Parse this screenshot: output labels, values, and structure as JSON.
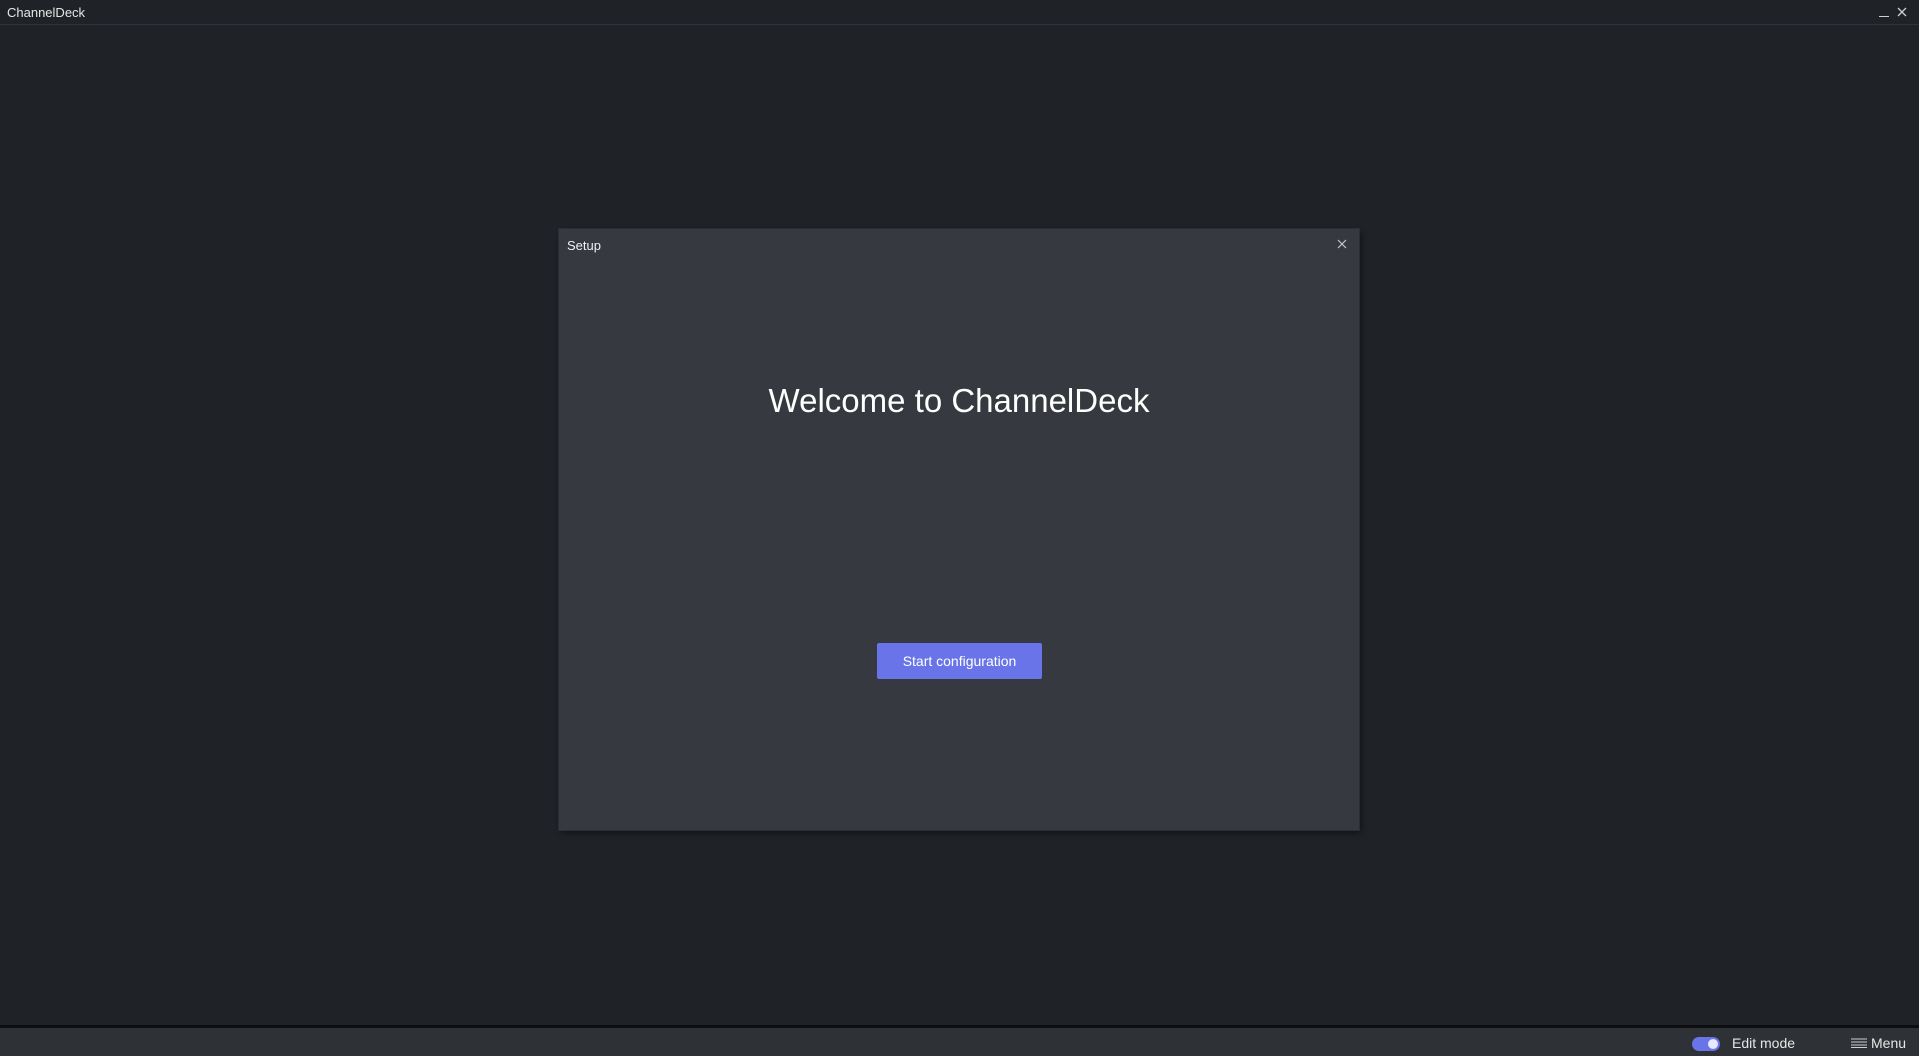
{
  "window": {
    "title": "ChannelDeck",
    "minimize_glyph": "_",
    "close_glyph": "✕"
  },
  "dialog": {
    "title": "Setup",
    "heading": "Welcome to ChannelDeck",
    "start_button_label": "Start configuration",
    "close_icon": "close-icon"
  },
  "bottombar": {
    "edit_mode_label": "Edit mode",
    "edit_mode_enabled": true,
    "menu_label": "Menu",
    "menu_icon": "hamburger-icon"
  },
  "colors": {
    "background": "#1f2227",
    "dialog_background": "#36393f",
    "accent": "#6874e8",
    "bottombar": "#2e3136"
  }
}
